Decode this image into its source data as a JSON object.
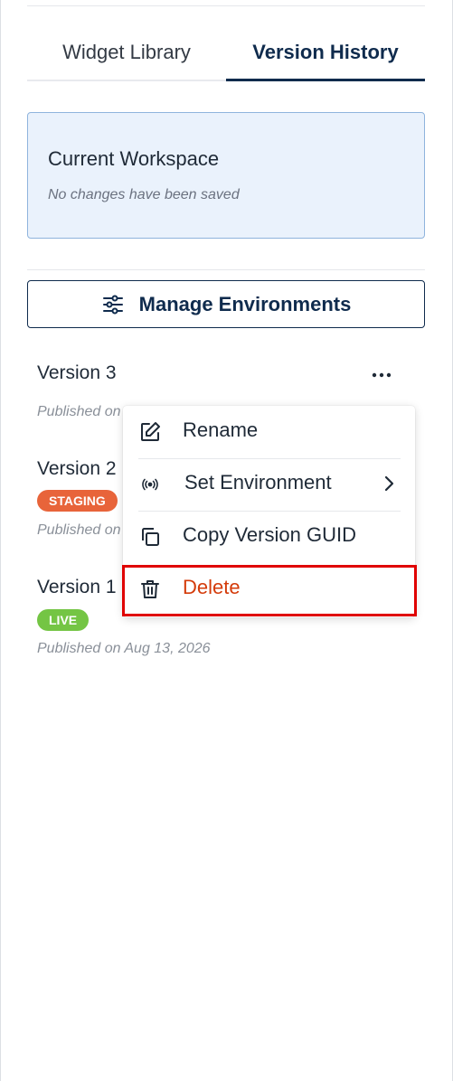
{
  "tabs": [
    {
      "label": "Widget Library",
      "active": false
    },
    {
      "label": "Version History",
      "active": true
    }
  ],
  "workspace": {
    "title": "Current Workspace",
    "status": "No changes have been saved"
  },
  "manage_environments": {
    "label": "Manage Environments",
    "icon": "sliders-icon"
  },
  "versions": [
    {
      "title": "Version 3",
      "badge": "",
      "date": "Published on"
    },
    {
      "title": "Version 2",
      "badge": "STAGING",
      "date": "Published on"
    },
    {
      "title": "Version 1",
      "badge": "LIVE",
      "date": "Published on Aug 13, 2026"
    }
  ],
  "context_menu": {
    "items": [
      {
        "label": "Rename",
        "icon": "edit-icon"
      },
      {
        "label": "Set Environment",
        "icon": "broadcast-icon",
        "has_submenu": true
      },
      {
        "label": "Copy Version GUID",
        "icon": "copy-icon"
      },
      {
        "label": "Delete",
        "icon": "trash-icon",
        "destructive": true
      }
    ]
  },
  "colors": {
    "primary": "#0f2b4d",
    "staging": "#e8643a",
    "live": "#74c544",
    "delete": "#d43b0a",
    "highlight": "#e00000"
  }
}
